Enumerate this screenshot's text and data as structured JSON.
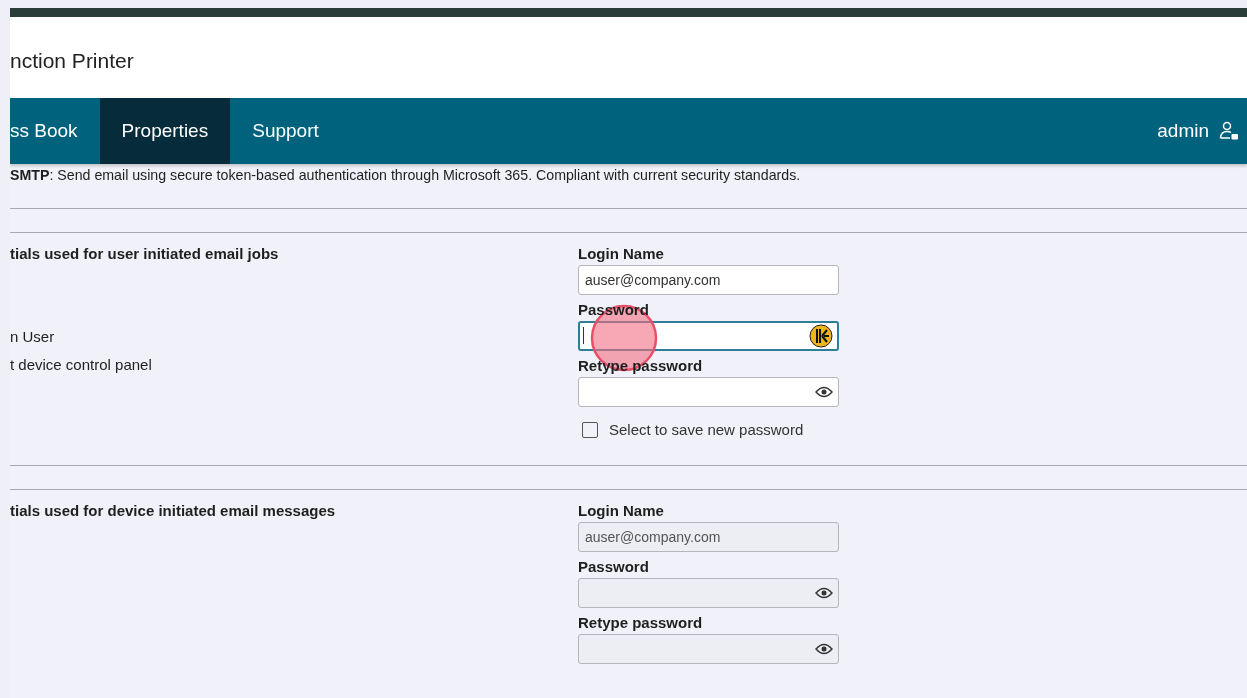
{
  "header": {
    "title": "nction Printer"
  },
  "nav": {
    "tabs": [
      {
        "label": "ss Book",
        "selected": false
      },
      {
        "label": "Properties",
        "selected": true
      },
      {
        "label": "Support",
        "selected": false
      }
    ],
    "user": "admin"
  },
  "description": "**SMTP**: Send email using secure token-based authentication through Microsoft 365. Compliant with current security standards.",
  "sections": [
    {
      "heading": "tials used for user initiated email jobs",
      "notes": [
        "n User",
        "t device control panel"
      ],
      "fields": [
        {
          "kind": "text",
          "label": "Login Name",
          "value": "auser@company.com",
          "focused": false,
          "disabled": false
        },
        {
          "kind": "password",
          "label": "Password",
          "focused": true,
          "disabled": false,
          "clicked": true
        },
        {
          "kind": "password",
          "label": "Retype password",
          "focused": false,
          "disabled": false
        }
      ],
      "checkbox": {
        "label": "Select to save new password",
        "checked": false
      }
    },
    {
      "heading": "tials used for device initiated email messages",
      "fields": [
        {
          "kind": "text",
          "label": "Login Name",
          "value": "auser@company.com",
          "focused": false,
          "disabled": true
        },
        {
          "kind": "password",
          "label": "Password",
          "focused": false,
          "disabled": true
        },
        {
          "kind": "password",
          "label": "Retype password",
          "focused": false,
          "disabled": true
        }
      ]
    }
  ]
}
